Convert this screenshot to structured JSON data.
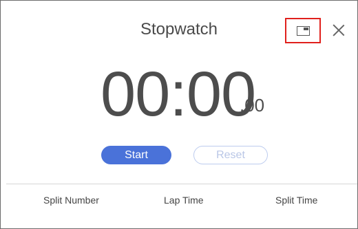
{
  "window": {
    "title": "Stopwatch"
  },
  "controls": {
    "pip_icon": "picture-in-picture-icon",
    "close_icon": "close-icon"
  },
  "display": {
    "time": "00:00",
    "fraction": ".00"
  },
  "buttons": {
    "start": "Start",
    "reset": "Reset"
  },
  "table": {
    "headers": [
      "Split Number",
      "Lap Time",
      "Split Time"
    ]
  },
  "colors": {
    "accent": "#4a72d9",
    "highlight": "#e0201c",
    "reset_border": "#bccbee"
  }
}
